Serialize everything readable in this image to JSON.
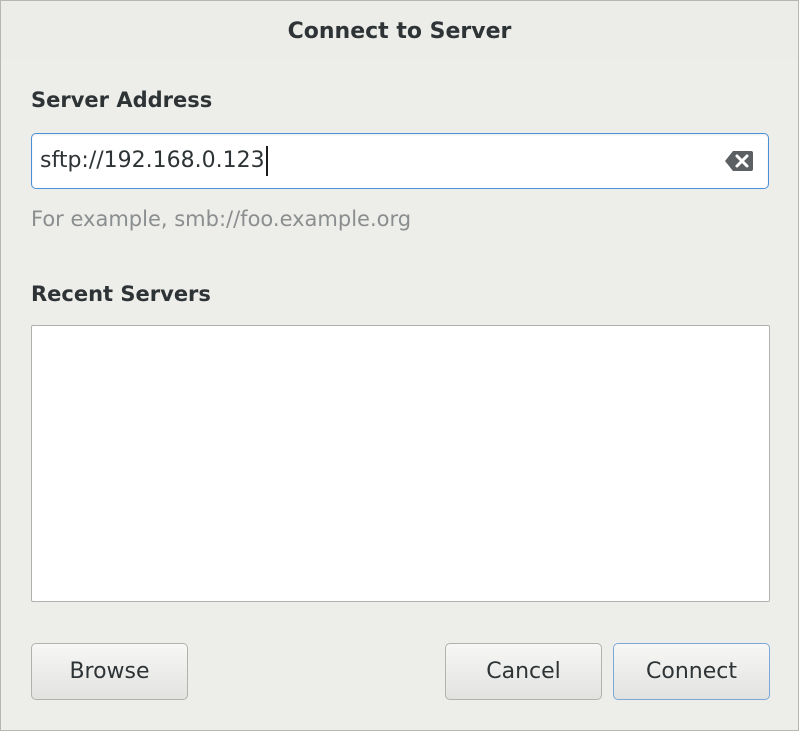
{
  "dialog": {
    "title": "Connect to Server"
  },
  "server_address": {
    "label": "Server Address",
    "value": "sftp://192.168.0.123",
    "hint": "For example, smb://foo.example.org",
    "clear_icon": "edit-clear-icon"
  },
  "recent_servers": {
    "label": "Recent Servers",
    "items": []
  },
  "buttons": {
    "browse": "Browse",
    "cancel": "Cancel",
    "connect": "Connect"
  },
  "colors": {
    "focus_border": "#4a90d9",
    "background": "#ededea",
    "text": "#2e3436",
    "hint_text": "#8b8e8f"
  }
}
